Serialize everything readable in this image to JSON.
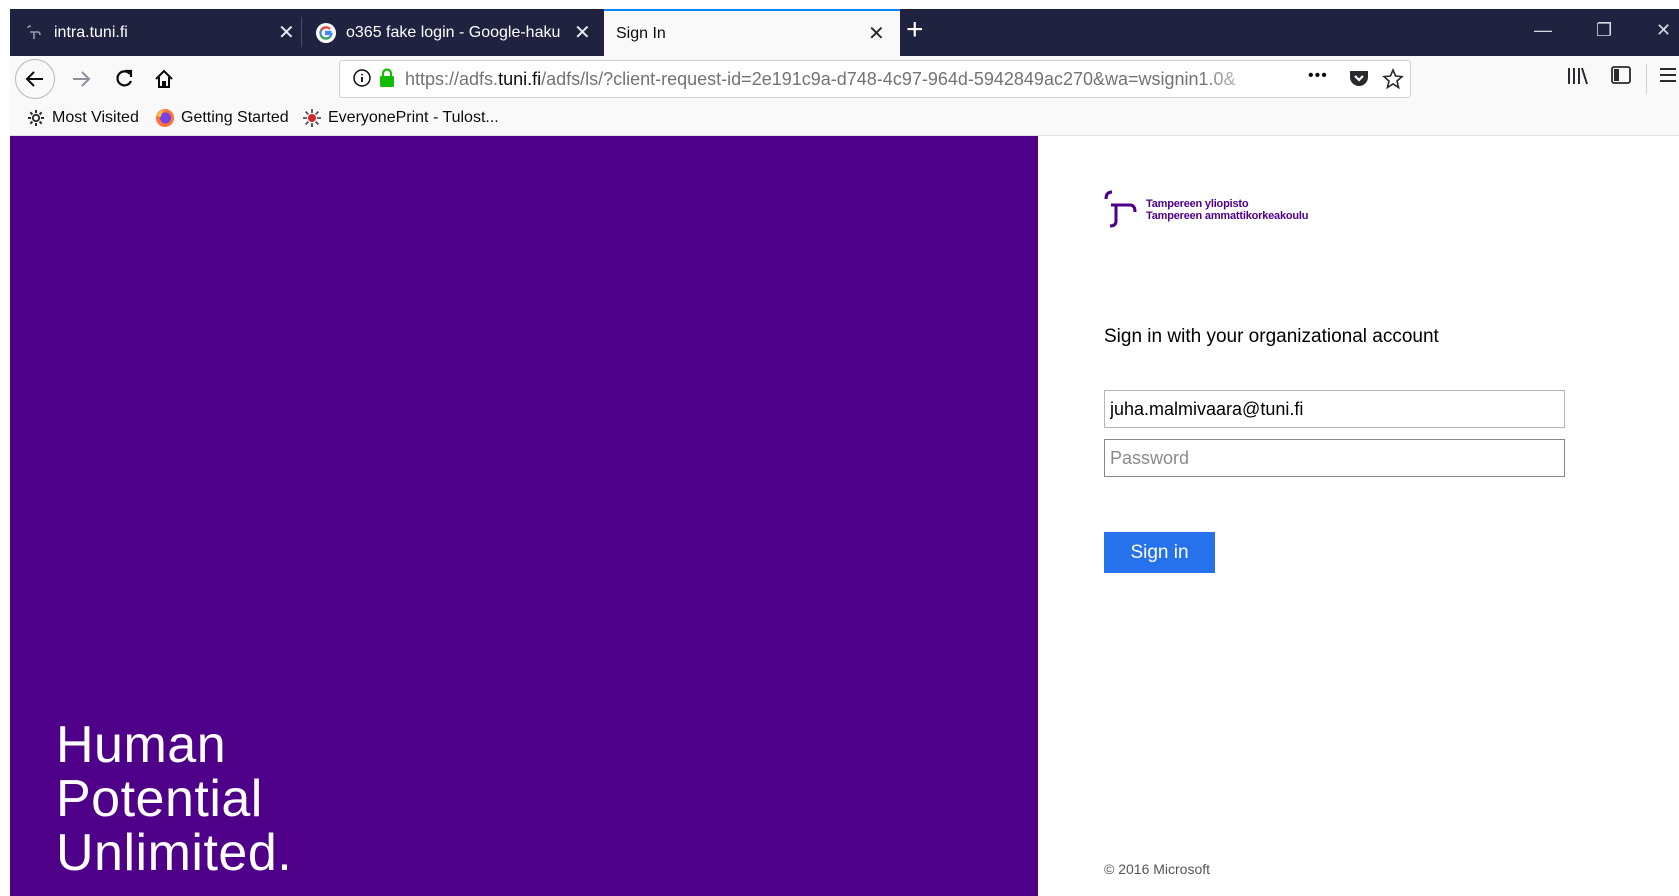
{
  "browser": {
    "tabs": [
      {
        "title": "intra.tuni.fi",
        "favicon": "tuni-logo-icon",
        "active": false
      },
      {
        "title": "o365 fake login - Google-haku",
        "favicon": "google-g-icon",
        "active": false
      },
      {
        "title": "Sign In",
        "favicon": "",
        "active": true
      }
    ],
    "new_tab_icon": "plus-icon",
    "window_controls": {
      "minimize": "—",
      "restore": "❐",
      "close": "✕"
    },
    "nav": {
      "back_icon": "back-arrow-icon",
      "forward_icon": "forward-arrow-icon",
      "reload_icon": "reload-icon",
      "home_icon": "home-icon"
    },
    "url": {
      "scheme": "https://adfs.",
      "host": "tuni.fi",
      "path": "/adfs/ls/?client-request-id=2e191c9a-d748-4c97-964d-5942849ac270&wa=wsignin1.0&"
    },
    "page_actions": {
      "more": "•••",
      "pocket_icon": "pocket-icon",
      "bookmark_icon": "star-icon"
    },
    "toolbar_right": {
      "library_icon": "library-icon",
      "sidebar_icon": "sidebar-icon",
      "menu_icon": "hamburger-menu-icon"
    },
    "bookmarks": [
      {
        "label": "Most Visited",
        "icon": "gear-icon"
      },
      {
        "label": "Getting Started",
        "icon": "firefox-icon"
      },
      {
        "label": "EveryonePrint - Tulost...",
        "icon": "everyoneprint-icon"
      }
    ]
  },
  "page": {
    "hero": {
      "line1": "Human",
      "line2": "Potential",
      "line3": "Unlimited."
    },
    "logo": {
      "line1": "Tampereen yliopisto",
      "line2": "Tampereen ammattikorkeakoulu"
    },
    "signin_title": "Sign in with your organizational account",
    "username": {
      "value": "juha.malmivaara@tuni.fi"
    },
    "password": {
      "placeholder": "Password",
      "value": ""
    },
    "signin_button": "Sign in",
    "footer": "© 2016 Microsoft",
    "colors": {
      "brand_purple": "#4e0088",
      "button_blue": "#2672ec"
    }
  }
}
